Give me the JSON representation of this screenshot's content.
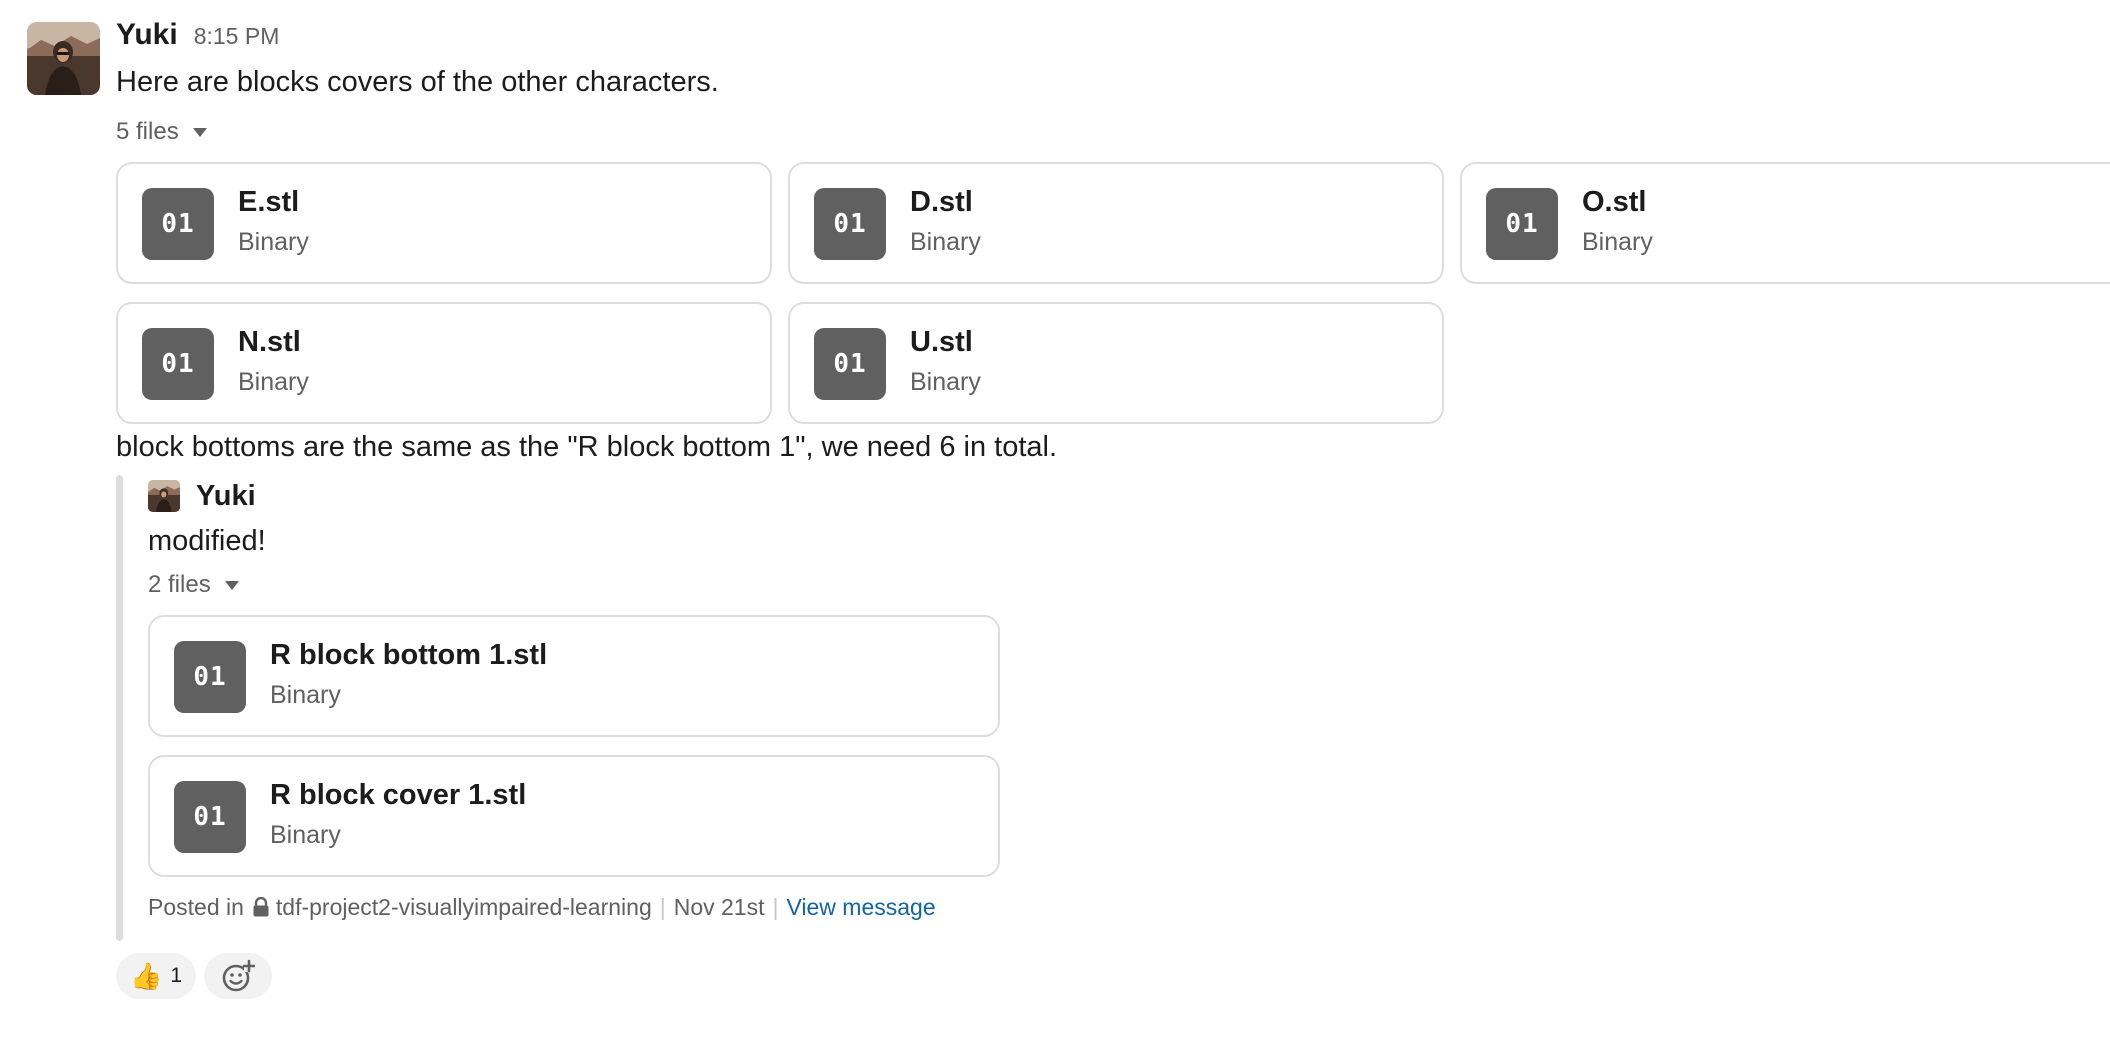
{
  "message": {
    "author": "Yuki",
    "time": "8:15 PM",
    "text": "Here are blocks covers of the other characters.",
    "files_toggle": "5 files",
    "files": [
      {
        "name": "E.stl",
        "type": "Binary",
        "icon": "01"
      },
      {
        "name": "D.stl",
        "type": "Binary",
        "icon": "01"
      },
      {
        "name": "O.stl",
        "type": "Binary",
        "icon": "01"
      },
      {
        "name": "N.stl",
        "type": "Binary",
        "icon": "01"
      },
      {
        "name": "U.stl",
        "type": "Binary",
        "icon": "01"
      }
    ],
    "text2": "block bottoms are the same as the \"R block bottom 1\", we need 6 in total."
  },
  "quoted": {
    "author": "Yuki",
    "text": "modified!",
    "files_toggle": "2 files",
    "files": [
      {
        "name": "R block bottom 1.stl",
        "type": "Binary",
        "icon": "01"
      },
      {
        "name": "R block cover 1.stl",
        "type": "Binary",
        "icon": "01"
      }
    ],
    "posted_in_label": "Posted in",
    "channel": "tdf-project2-visuallyimpaired-learning",
    "date": "Nov 21st",
    "view_link": "View message"
  },
  "reactions": [
    {
      "emoji": "👍",
      "count": "1"
    }
  ],
  "icons": {
    "file": "binary-file-icon",
    "lock": "lock-icon",
    "add_reaction": "add-reaction-icon",
    "caret": "caret-down-icon"
  },
  "colors": {
    "link": "#1264a3",
    "muted": "#616061",
    "file_icon_bg": "#616061"
  }
}
